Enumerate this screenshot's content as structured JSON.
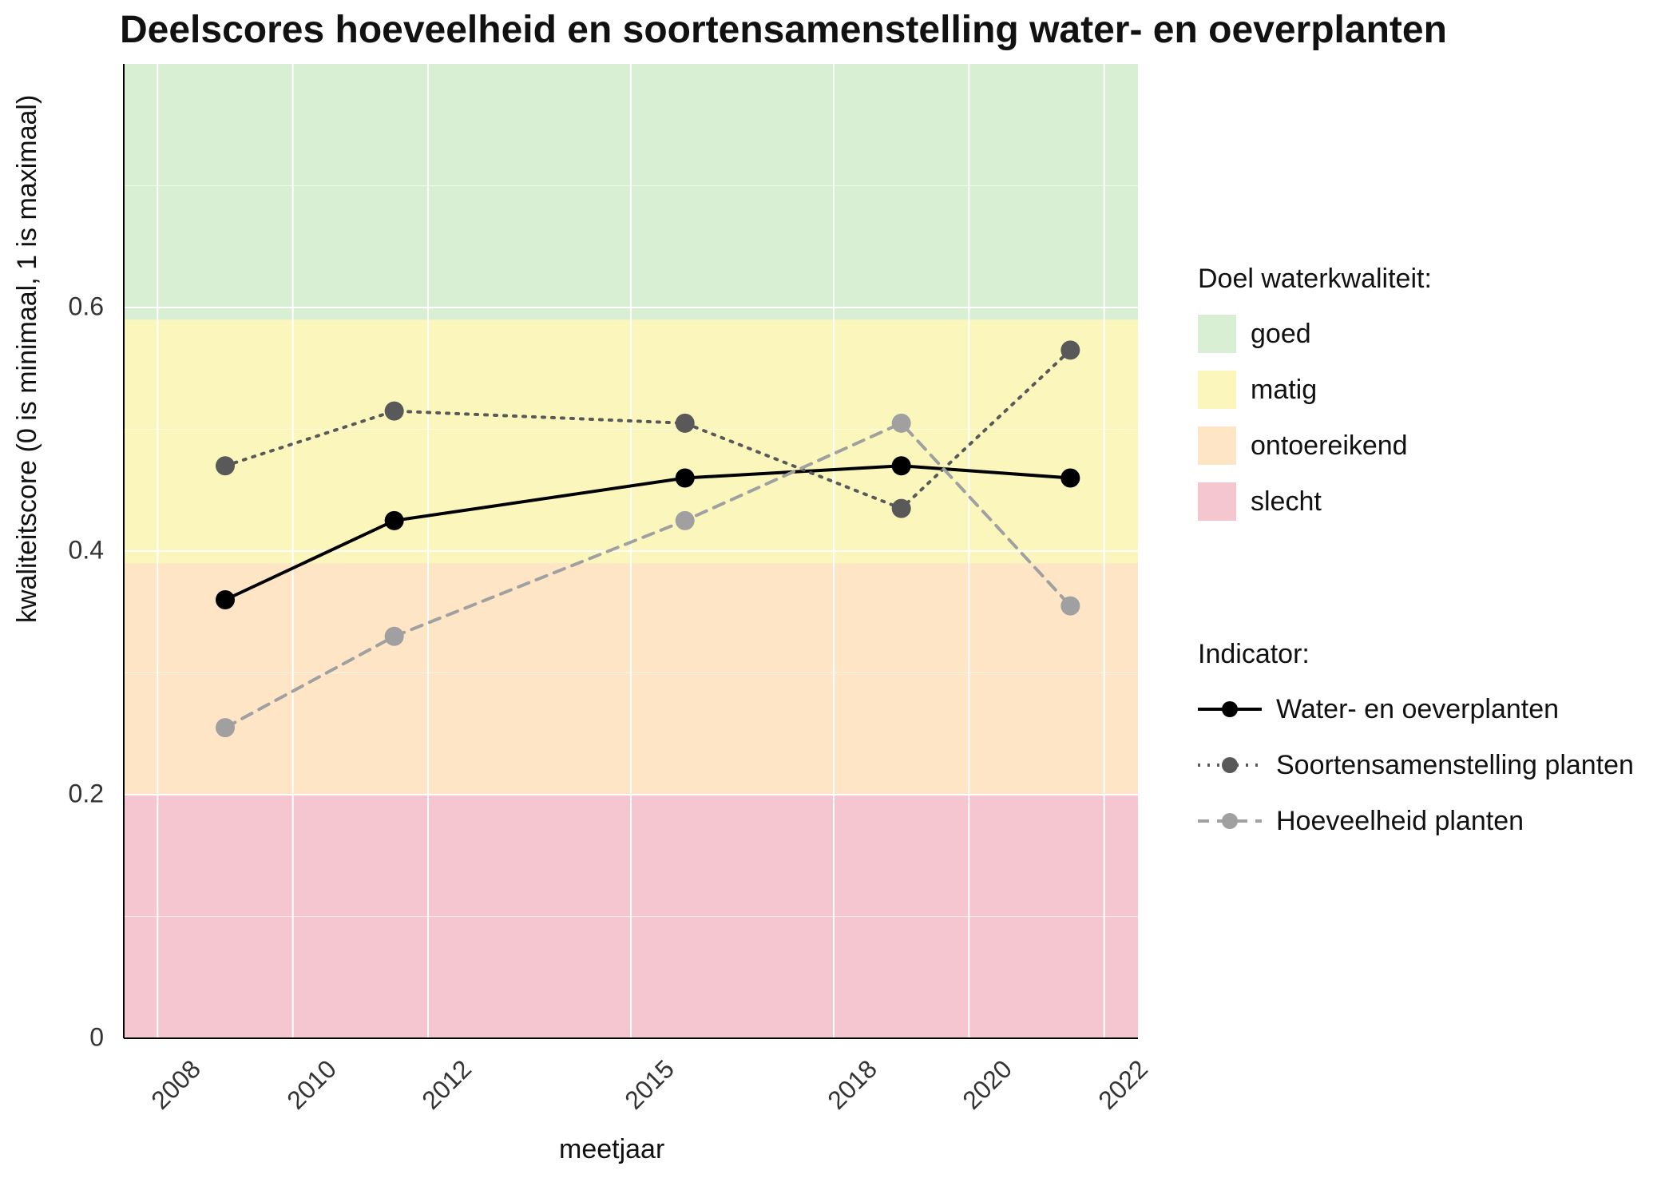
{
  "chart_data": {
    "type": "line",
    "title": "Deelscores hoeveelheid en soortensamenstelling water- en oeverplanten",
    "xlabel": "meetjaar",
    "ylabel": "kwaliteitscore (0 is minimaal, 1 is maximaal)",
    "x_ticks": [
      2008,
      2010,
      2012,
      2015,
      2018,
      2020,
      2022
    ],
    "y_ticks": [
      0.0,
      0.2,
      0.4,
      0.6
    ],
    "xlim": [
      2007.5,
      2022.5
    ],
    "ylim": [
      0.0,
      0.8
    ],
    "background_bands": [
      {
        "name": "slecht",
        "from": 0.0,
        "to": 0.2,
        "color": "#f5c6cf"
      },
      {
        "name": "ontoereikend",
        "from": 0.2,
        "to": 0.39,
        "color": "#fde5c6"
      },
      {
        "name": "matig",
        "from": 0.39,
        "to": 0.59,
        "color": "#fbf7bc"
      },
      {
        "name": "goed",
        "from": 0.59,
        "to": 0.8,
        "color": "#d9efd3"
      }
    ],
    "series": [
      {
        "name": "Water- en oeverplanten",
        "color": "#000000",
        "line_style": "solid",
        "x": [
          2009,
          2011.5,
          2015.8,
          2019,
          2021.5
        ],
        "y": [
          0.36,
          0.425,
          0.46,
          0.47,
          0.46
        ]
      },
      {
        "name": "Soortensamenstelling planten",
        "color": "#595959",
        "line_style": "dotted",
        "x": [
          2009,
          2011.5,
          2015.8,
          2019,
          2021.5
        ],
        "y": [
          0.47,
          0.515,
          0.505,
          0.435,
          0.565
        ]
      },
      {
        "name": "Hoeveelheid planten",
        "color": "#a0a0a0",
        "line_style": "dashed",
        "x": [
          2009,
          2011.5,
          2015.8,
          2019,
          2021.5
        ],
        "y": [
          0.255,
          0.33,
          0.425,
          0.505,
          0.355
        ]
      }
    ],
    "legend1_title": "Doel waterkwaliteit:",
    "legend1_items": [
      {
        "label": "goed",
        "color": "#d9efd3"
      },
      {
        "label": "matig",
        "color": "#fbf7bc"
      },
      {
        "label": "ontoereikend",
        "color": "#fde5c6"
      },
      {
        "label": "slecht",
        "color": "#f5c6cf"
      }
    ],
    "legend2_title": "Indicator:",
    "legend2_items": [
      {
        "label": "Water- en oeverplanten",
        "color": "#000000",
        "style": "solid"
      },
      {
        "label": "Soortensamenstelling planten",
        "color": "#595959",
        "style": "dotted"
      },
      {
        "label": "Hoeveelheid planten",
        "color": "#a0a0a0",
        "style": "dashed"
      }
    ]
  }
}
